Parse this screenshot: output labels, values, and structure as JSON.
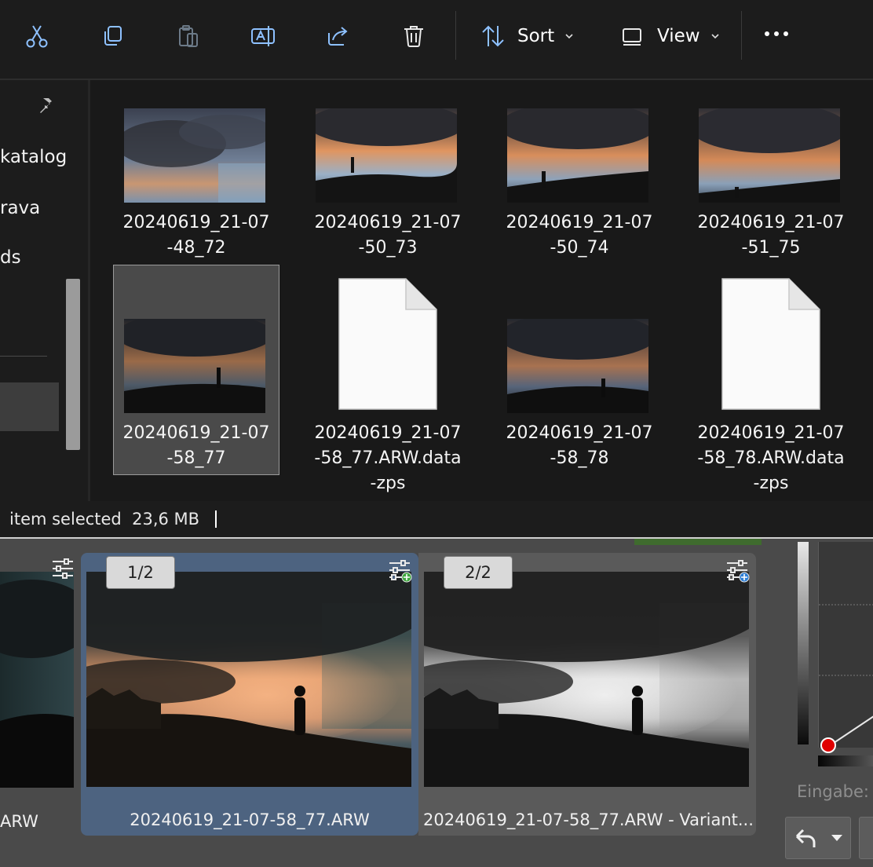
{
  "toolbar": {
    "icons": [
      "cut-icon",
      "copy-icon",
      "paste-icon",
      "rename-icon",
      "share-icon",
      "delete-icon"
    ],
    "sort_label": "Sort",
    "view_label": "View"
  },
  "nav": {
    "items": [
      "katalog",
      "rava",
      "ds"
    ]
  },
  "files": [
    {
      "line1": "20240619_21-07",
      "line2": "-48_72",
      "line3": "",
      "type": "image",
      "theme": "blue"
    },
    {
      "line1": "20240619_21-07",
      "line2": "-50_73",
      "line3": "",
      "type": "image",
      "theme": "warm"
    },
    {
      "line1": "20240619_21-07",
      "line2": "-50_74",
      "line3": "",
      "type": "image",
      "theme": "warm"
    },
    {
      "line1": "20240619_21-07",
      "line2": "-51_75",
      "line3": "",
      "type": "image",
      "theme": "warm"
    },
    {
      "line1": "20240619_21-07",
      "line2": "-58_77",
      "line3": "",
      "type": "image",
      "theme": "dark",
      "selected": true
    },
    {
      "line1": "20240619_21-07",
      "line2": "-58_77.ARW.data",
      "line3": "-zps",
      "type": "document"
    },
    {
      "line1": "20240619_21-07",
      "line2": "-58_78",
      "line3": "",
      "type": "image",
      "theme": "dark"
    },
    {
      "line1": "20240619_21-07",
      "line2": "-58_78.ARW.data",
      "line3": "-zps",
      "type": "document"
    }
  ],
  "status": {
    "text": "item selected  23,6 MB"
  },
  "filmstrip": {
    "left_caption": "ARW",
    "items": [
      {
        "badge": "1/2",
        "caption": "20240619_21-07-58_77.ARW"
      },
      {
        "badge": "2/2",
        "caption": "20240619_21-07-58_77.ARW - Variant..."
      }
    ]
  },
  "panel": {
    "input_label": "Eingabe:"
  },
  "colors": {
    "selected_filmstrip": "#4d6380",
    "curve_point": "#e00000"
  }
}
